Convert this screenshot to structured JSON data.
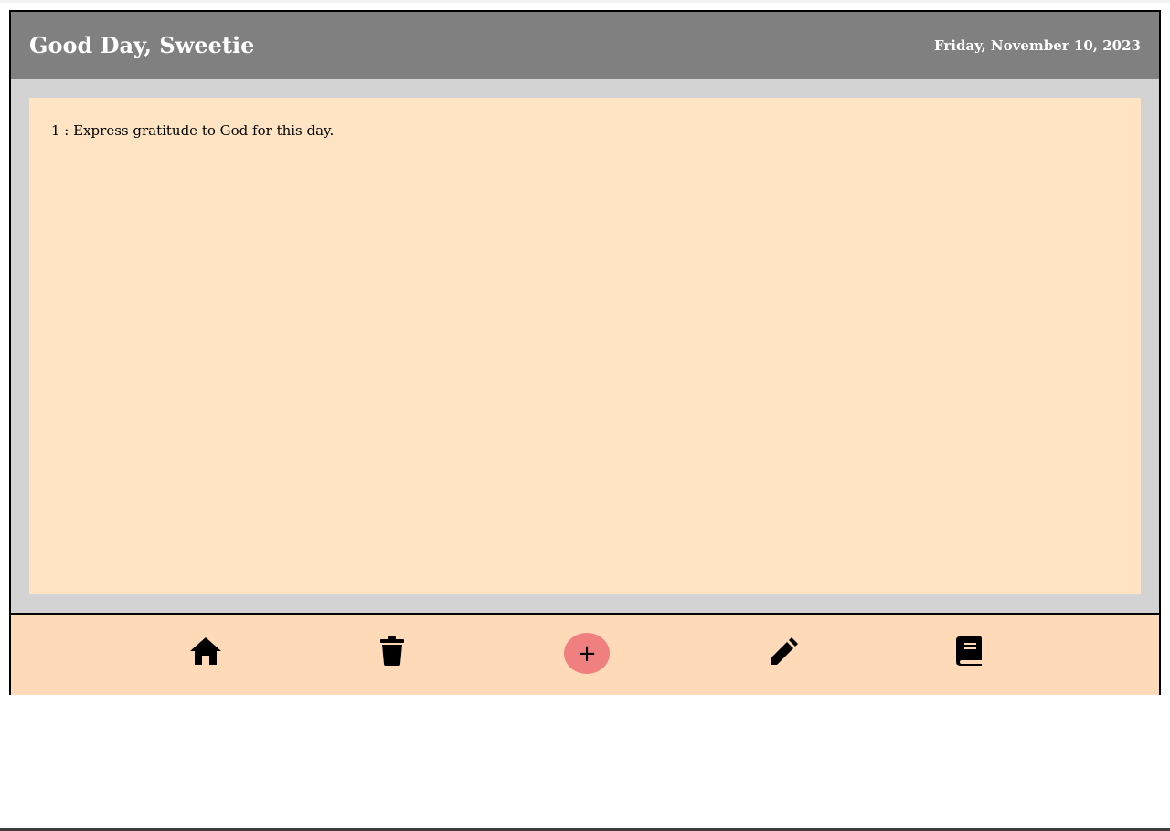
{
  "header": {
    "greeting": "Good Day, Sweetie",
    "date": "Friday, November 10, 2023"
  },
  "tasks": [
    {
      "label": "1 : Express gratitude to God for this day."
    }
  ],
  "nav": {
    "home_icon": "home-icon",
    "delete_icon": "trash-icon",
    "add_label": "+",
    "edit_icon": "pencil-icon",
    "journal_icon": "book-icon"
  },
  "colors": {
    "header_bg": "#808080",
    "app_bg": "#d3d3d3",
    "panel_bg": "#ffe4c4",
    "nav_bg": "#ffdab9",
    "add_button": "#f08080"
  }
}
